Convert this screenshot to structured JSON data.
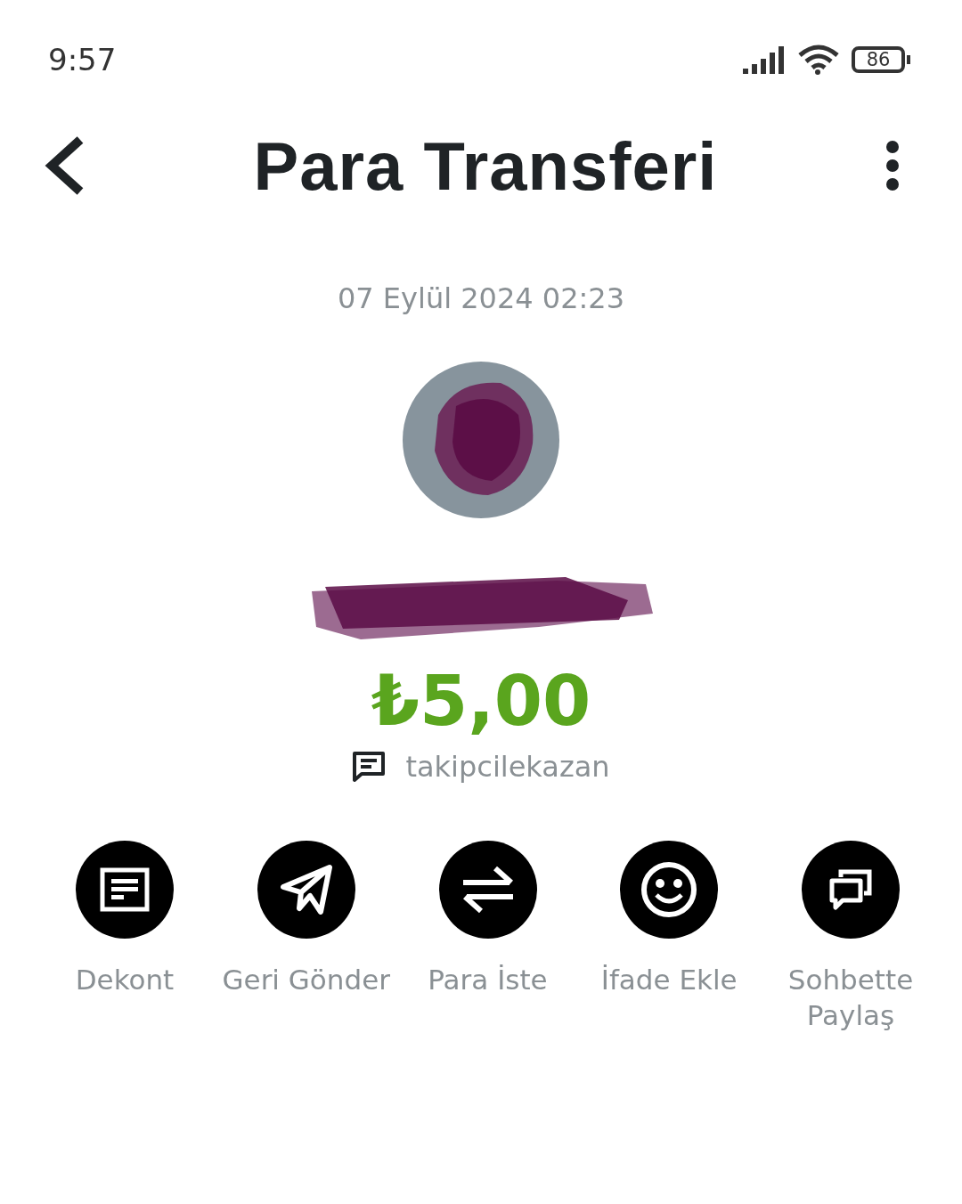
{
  "status_bar": {
    "time": "9:57",
    "battery": "86"
  },
  "header": {
    "title": "Para Transferi"
  },
  "date": "07 Eylül 2024 02:23",
  "amount": "₺5,00",
  "note": "takipcilekazan",
  "actions": [
    {
      "kind": "receipt",
      "label": "Dekont"
    },
    {
      "kind": "send",
      "label": "Geri Gönder"
    },
    {
      "kind": "exchange",
      "label": "Para İste"
    },
    {
      "kind": "emoji",
      "label": "İfade Ekle"
    },
    {
      "kind": "chat",
      "label": "Sohbette Paylaş"
    }
  ]
}
